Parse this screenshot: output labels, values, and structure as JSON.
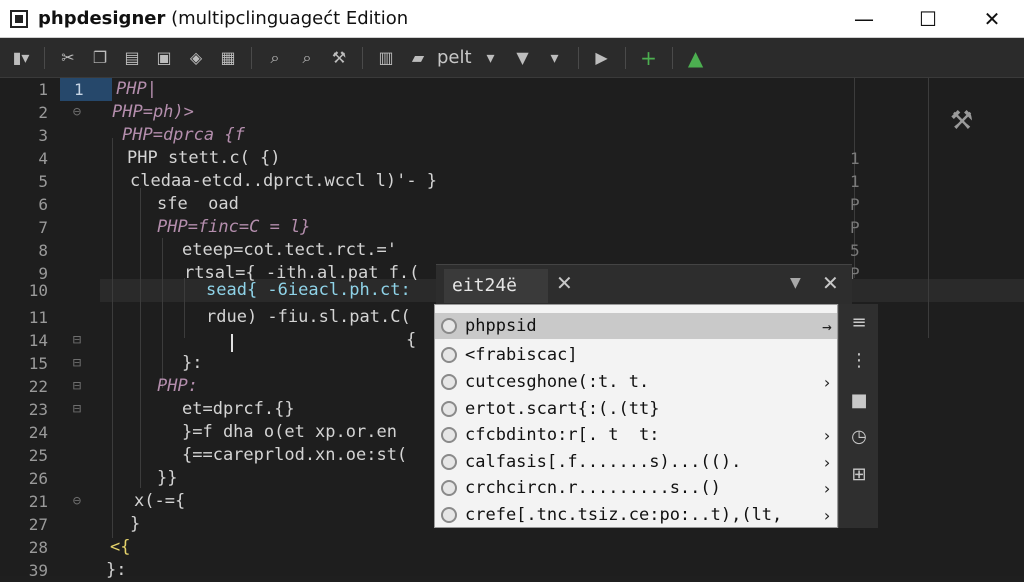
{
  "window": {
    "title_bold": "phpdesigner",
    "title_rest": " (multipclinguagećt Edition",
    "minimize": "—",
    "maximize": "☐",
    "close": "✕"
  },
  "toolbar": {
    "label": "pelt"
  },
  "editor": {
    "lines": [
      {
        "no": "1",
        "code": "PHP|",
        "fold": ""
      },
      {
        "no": "2",
        "code": "PHP=ph)>",
        "fold": "⊖"
      },
      {
        "no": "3",
        "code": "PHP=dprca {f",
        "fold": ""
      },
      {
        "no": "4",
        "code": "PHP stett.c( {)",
        "fold": ""
      },
      {
        "no": "5",
        "code": "cledaa-etcd..dprct.wccl l)'- }",
        "fold": ""
      },
      {
        "no": "6",
        "code": "sfe  oad",
        "fold": ""
      },
      {
        "no": "7",
        "code": "PHP=finc=C = l}",
        "fold": ""
      },
      {
        "no": "8",
        "code": "eteep=cot.tect.rct.='",
        "fold": ""
      },
      {
        "no": "9",
        "code": "rtsal={ -ith.al.pat f.(",
        "fold": ""
      },
      {
        "no": "10",
        "code": "sead{ -6ieacl.ph.ct:",
        "fold": ""
      },
      {
        "no": "11",
        "code": "rdue) -fiu.sl.pat.C(",
        "fold": ""
      },
      {
        "no": "14",
        "code": "{",
        "fold": "⊟"
      },
      {
        "no": "15",
        "code": "}:",
        "fold": "⊟"
      },
      {
        "no": "22",
        "code": "PHP:",
        "fold": "⊟"
      },
      {
        "no": "23",
        "code": "et=dprcf.{}",
        "fold": "⊟"
      },
      {
        "no": "24",
        "code": "}=f dha o(et xp.or.en",
        "fold": ""
      },
      {
        "no": "25",
        "code": "{==careprlod.xn.oe:st(",
        "fold": ""
      },
      {
        "no": "26",
        "code": "}}",
        "fold": ""
      },
      {
        "no": "21",
        "code": "x(-={",
        "fold": "⊖"
      },
      {
        "no": "27",
        "code": "}",
        "fold": ""
      },
      {
        "no": "28",
        "code": "<{",
        "fold": ""
      },
      {
        "no": "39",
        "code": "}:",
        "fold": ""
      }
    ],
    "line1_indicator": "1",
    "right_marks": [
      "1",
      "1",
      "P",
      "P",
      "5",
      "P"
    ]
  },
  "popup": {
    "tab_label": "eit24ë",
    "items": [
      {
        "label": "phppsid",
        "arrow": "→"
      },
      {
        "label": "<frabiscac]",
        "arrow": ""
      },
      {
        "label": "cutcesghone(:t. t.",
        "arrow": "›"
      },
      {
        "label": "ertot.scart{:(.(tt}",
        "arrow": ""
      },
      {
        "label": "cfcbdinto:r[. t  t:",
        "arrow": "›"
      },
      {
        "label": "calfasis[.f.......s)...(().",
        "arrow": "›"
      },
      {
        "label": "crchcircn.r.........s..()",
        "arrow": "›"
      },
      {
        "label": "crefe[.tnc.tsiz.ce:po:..t),(lt,",
        "arrow": "›"
      }
    ]
  },
  "colors": {
    "php_keyword": "#b48ead",
    "background": "#1e1e1e"
  }
}
